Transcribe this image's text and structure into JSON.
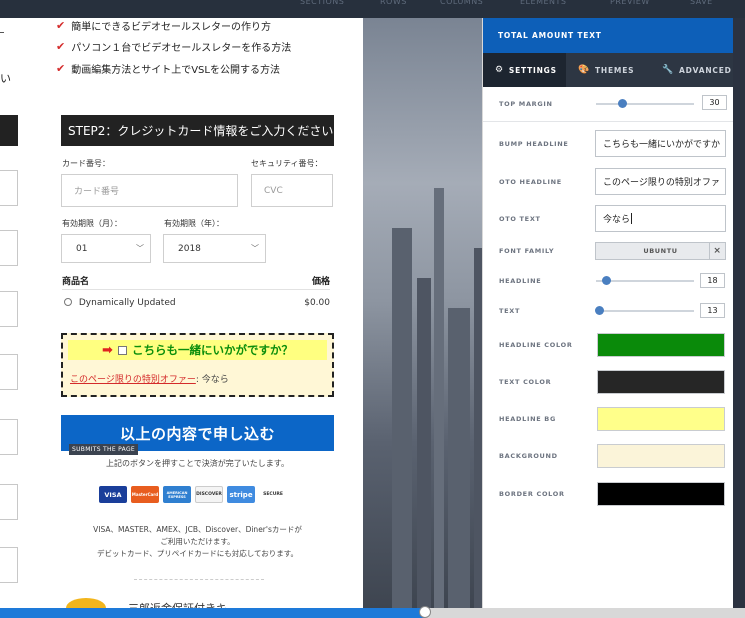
{
  "toolbar": {
    "items": [
      "SECTIONS",
      "ROWS",
      "COLUMNS",
      "ELEMENTS",
      "PREVIEW",
      "SAVE"
    ]
  },
  "page": {
    "bullets": [
      "簡単にできるビデオセールスレターの作り方",
      "パソコン１台でビデオセールスレターを作る方法",
      "動画編集方法とサイト上でVSLを公開する方法"
    ],
    "left_edge_fragment": "い",
    "step2_title": "STEP2：クレジットカード情報をご入力ください",
    "card_number_label": "カード番号：",
    "card_number_placeholder": "カード番号",
    "security_label": "セキュリティ番号：",
    "security_placeholder": "CVC",
    "exp_month_label": "有効期限（月）：",
    "exp_month_value": "01",
    "exp_year_label": "有効期限（年）：",
    "exp_year_value": "2018",
    "product_header": "商品名",
    "price_header": "価格",
    "product_name": "Dynamically Updated",
    "product_price": "$0.00",
    "bump_headline": "こちらも一緒にいかがですか？",
    "oto_headline": "このページ限りの特別オファー",
    "oto_text": ": 今なら",
    "submit_label": "以上の内容で申し込む",
    "submit_tag": "SUBMITS THE PAGE",
    "submit_note": "上記のボタンを押すことで決済が完了いたします。",
    "cards": [
      {
        "label": "VISA",
        "color": "#1a3e9a"
      },
      {
        "label": "MasterCard",
        "color": "#e85d1f"
      },
      {
        "label": "AMERICAN EXPRESS",
        "color": "#2f7fd0"
      },
      {
        "label": "DISCOVER",
        "color": "#f4f4f4"
      },
      {
        "label": "stripe",
        "color": "#3f8be0"
      },
      {
        "label": "SECURE",
        "color": "#ffffff"
      }
    ],
    "card_text_line1": "VISA、MASTER、AMEX、JCB、Discover、Diner'sカードが",
    "card_text_line2": "ご利用いただけます。",
    "card_text_line3": "デビットカード、プリペイドカードにも対応しております。",
    "bottom_title": "三郎返金保証付きキ"
  },
  "panel": {
    "title": "TOTAL AMOUNT TEXT",
    "tabs": [
      {
        "label": "SETTINGS",
        "icon": "gear-icon"
      },
      {
        "label": "THEMES",
        "icon": "palette-icon"
      },
      {
        "label": "ADVANCED",
        "icon": "wrench-icon"
      }
    ],
    "top_margin_label": "TOP MARGIN",
    "top_margin_value": "30",
    "top_margin_level": 0.27,
    "bump_headline_label": "BUMP HEADLINE",
    "bump_headline_value": "こちらも一緒にいかがですか",
    "oto_headline_label": "OTO HEADLINE",
    "oto_headline_value": "このページ限りの特別オファ",
    "oto_text_label": "OTO TEXT",
    "oto_text_value": "今なら",
    "font_family_label": "FONT FAMILY",
    "font_family_value": "UBUNTU",
    "font_clear": "×",
    "headline_label": "HEADLINE",
    "headline_value": "18",
    "headline_level": 0.1,
    "text_label": "TEXT",
    "text_value": "13",
    "text_level": 0.03,
    "headline_color_label": "HEADLINE COLOR",
    "headline_color": "#0a8a0a",
    "text_color_label": "TEXT COLOR",
    "text_color": "#262626",
    "headline_bg_label": "HEADLINE BG",
    "headline_bg": "#ffff8a",
    "background_label": "BACKGROUND",
    "background": "#fbf4d9",
    "border_color_label": "BORDER COLOR",
    "border_color": "#000000"
  },
  "scrubber": {
    "progress": 0.57,
    "accent": "#1e7ad9"
  }
}
